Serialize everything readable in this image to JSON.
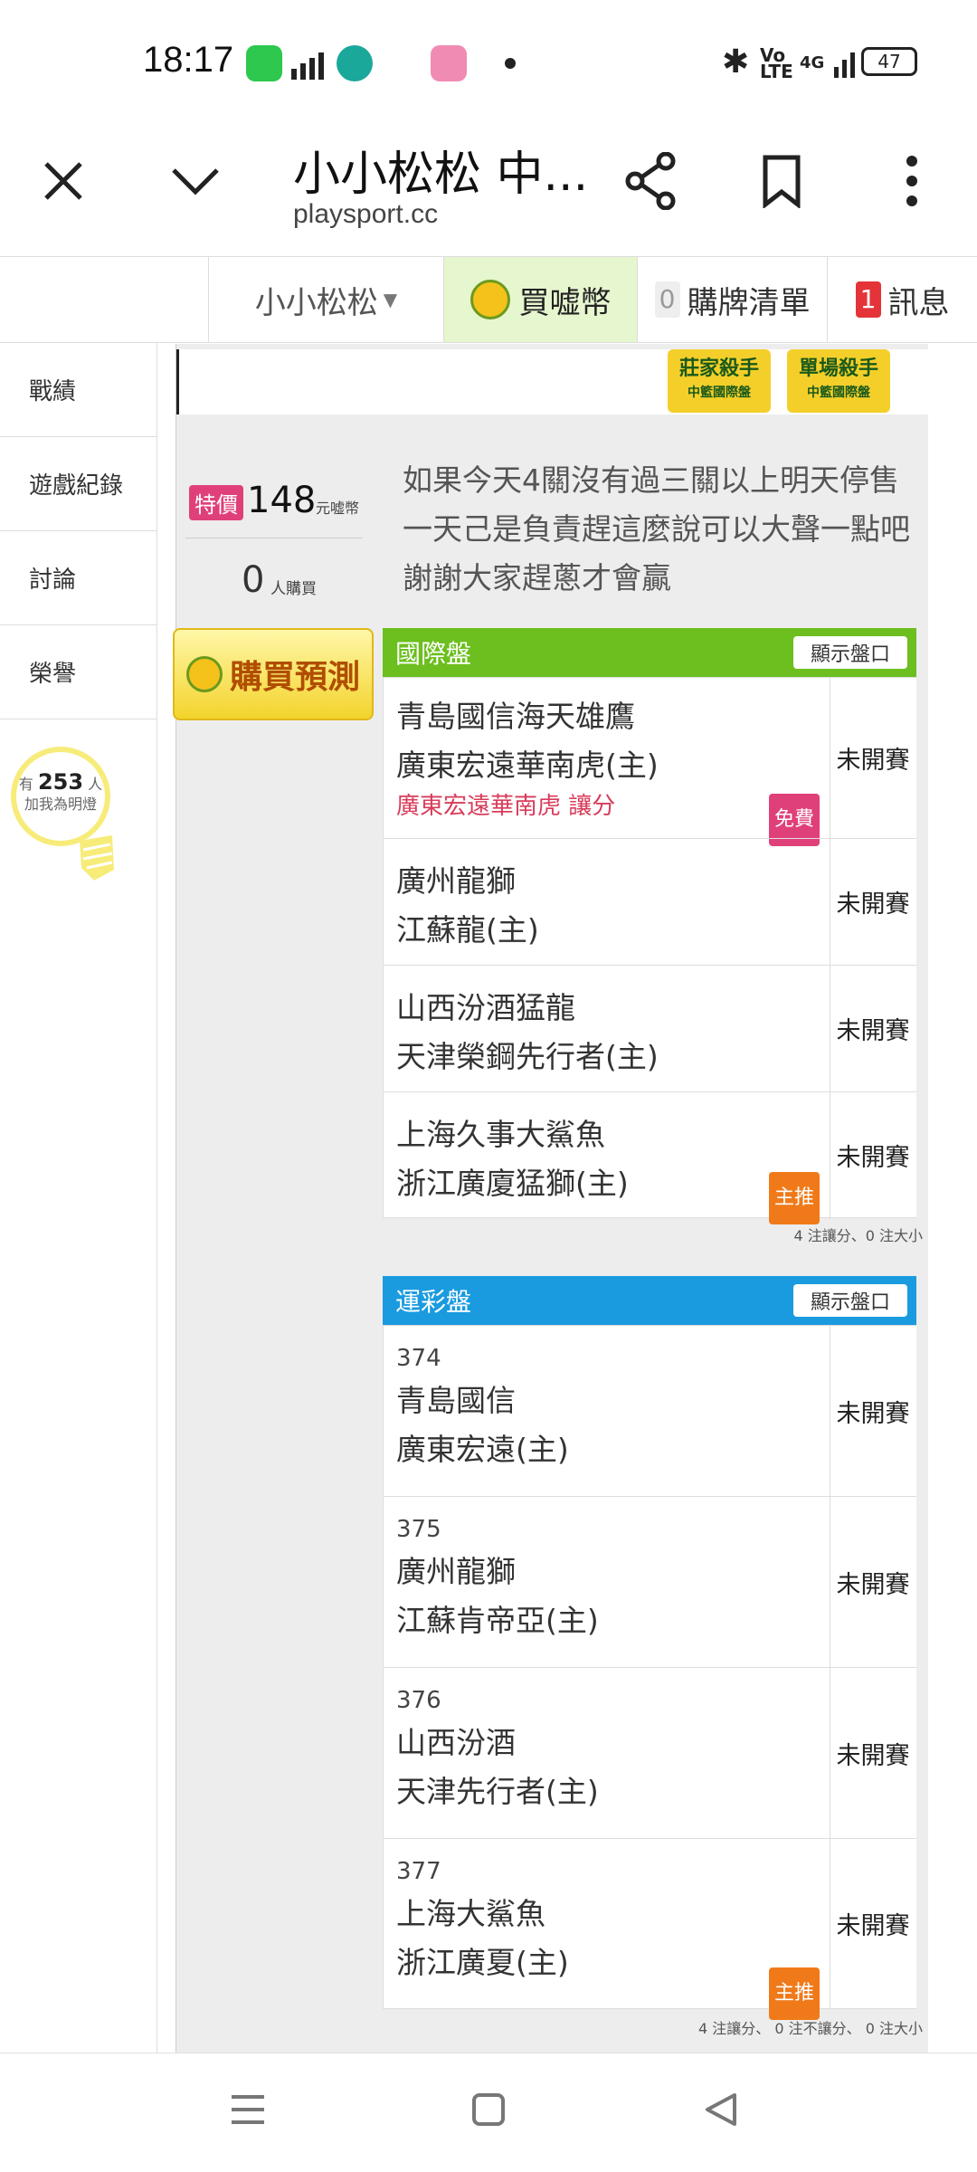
{
  "status_bar": {
    "time": "18:17",
    "battery": "47",
    "network": "4G"
  },
  "toolbar": {
    "title": "小小松松 中...",
    "url": "playsport.cc"
  },
  "site_nav": {
    "user": "小小松松",
    "buy_coins": "買嘘幣",
    "cart_count": "0",
    "cart": "購牌清單",
    "msg_count": "1",
    "msg": "訊息"
  },
  "sidebar": {
    "items": [
      "戰績",
      "遊戲紀錄",
      "討論",
      "榮譽"
    ],
    "fans_prefix": "有",
    "fans_count": "253",
    "fans_suffix": "人",
    "fans_caption": "加我為明燈"
  },
  "banner": {
    "killer1": "莊家殺手",
    "killer1_sub": "中籃國際盤",
    "killer2": "單場殺手",
    "killer2_sub": "中籃國際盤"
  },
  "offer": {
    "special": "特價",
    "price": "148",
    "price_unit": "元嘘幣",
    "buyers": "0",
    "buyers_unit": "人購買",
    "buy_button": "購買預測",
    "description": "如果今天4關沒有過三關以上明天停售一天己是負責趕這麼說可以大聲一點吧謝謝大家趕蔥才會贏"
  },
  "intl": {
    "title": "國際盤",
    "show_btn": "顯示盤口",
    "rows": [
      {
        "away": "青島國信海天雄鷹",
        "home": "廣東宏遠華南虎(主)",
        "pick": "廣東宏遠華南虎 讓分",
        "tag": "免費",
        "status": "未開賽"
      },
      {
        "away": "廣州龍獅",
        "home": "江蘇龍(主)",
        "pick": "",
        "tag": "",
        "status": "未開賽"
      },
      {
        "away": "山西汾酒猛龍",
        "home": "天津榮鋼先行者(主)",
        "pick": "",
        "tag": "",
        "status": "未開賽"
      },
      {
        "away": "上海久事大鯊魚",
        "home": "浙江廣廈猛獅(主)",
        "pick": "",
        "tag": "主推",
        "status": "未開賽"
      }
    ],
    "note": "4 注讓分、0 注大小"
  },
  "lottery": {
    "title": "運彩盤",
    "show_btn": "顯示盤口",
    "rows": [
      {
        "num": "374",
        "away": "青島國信",
        "home": "廣東宏遠(主)",
        "tag": "",
        "status": "未開賽"
      },
      {
        "num": "375",
        "away": "廣州龍獅",
        "home": "江蘇肯帝亞(主)",
        "tag": "",
        "status": "未開賽"
      },
      {
        "num": "376",
        "away": "山西汾酒",
        "home": "天津先行者(主)",
        "tag": "",
        "status": "未開賽"
      },
      {
        "num": "377",
        "away": "上海大鯊魚",
        "home": "浙江廣夏(主)",
        "tag": "主推",
        "status": "未開賽"
      }
    ],
    "note": "4 注讓分、 0 注不讓分、 0 注大小"
  },
  "colors": {
    "intl_header": "#6cbf1e",
    "lottery_header": "#1a9be0",
    "free_tag": "#e0407a",
    "main_tag": "#f07a1a"
  }
}
